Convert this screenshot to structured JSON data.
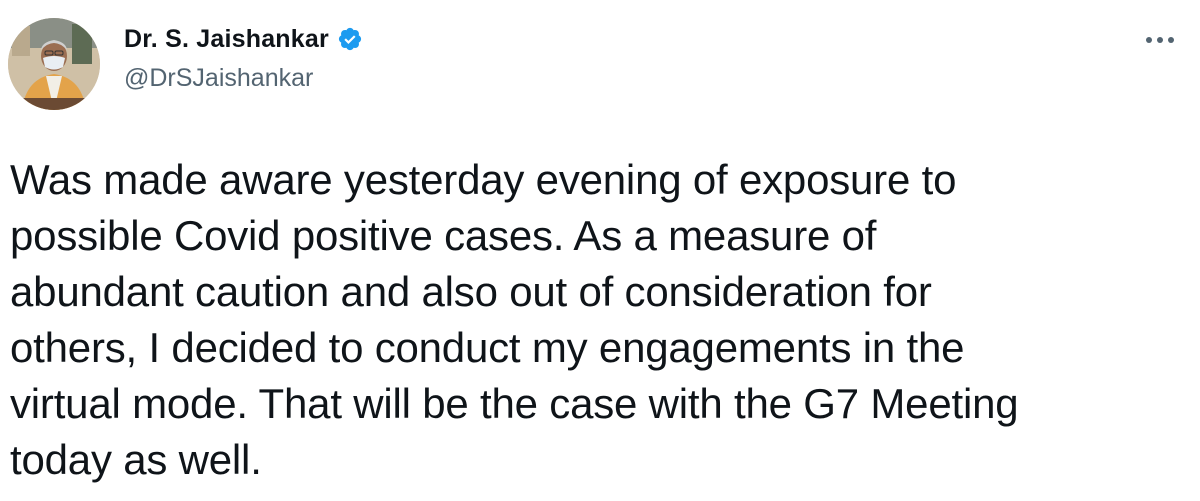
{
  "author": {
    "display_name": "Dr. S. Jaishankar",
    "handle": "@DrSJaishankar",
    "verified": true
  },
  "tweet": {
    "text": "Was made aware yesterday evening of exposure to\npossible Covid positive cases. As a measure of\nabundant caution and also out of consideration for\nothers, I decided to conduct my engagements in the\nvirtual mode. That will be the case with the G7 Meeting\ntoday as well."
  },
  "icons": {
    "verified": "verified-badge-icon",
    "more": "more-options-icon"
  },
  "colors": {
    "verified_blue": "#1d9bf0",
    "handle_gray": "#536471",
    "text": "#0f1419"
  }
}
